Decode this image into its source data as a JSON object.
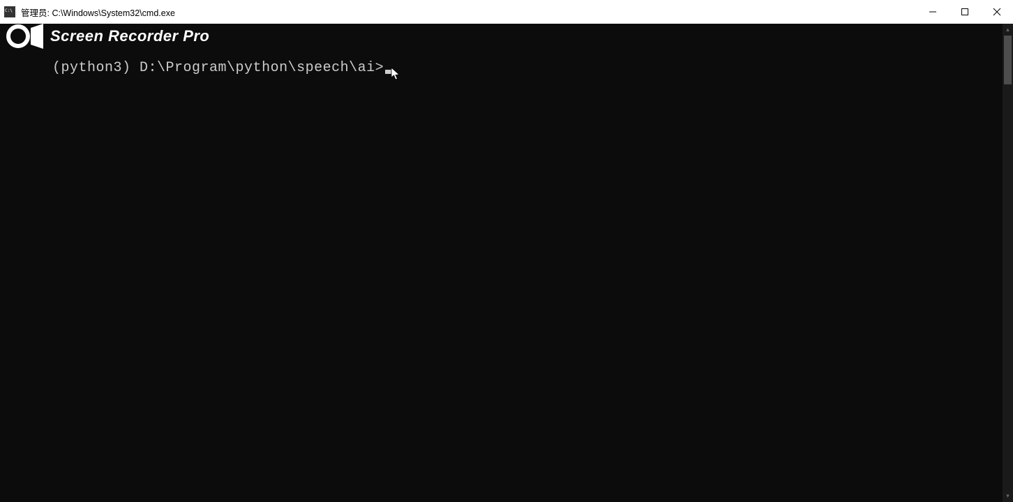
{
  "window": {
    "title_prefix": "管理员: ",
    "title_path": "C:\\Windows\\System32\\cmd.exe"
  },
  "watermark": {
    "text": "Screen Recorder Pro"
  },
  "terminal": {
    "prompt": "(python3) D:\\Program\\python\\speech\\ai>"
  }
}
